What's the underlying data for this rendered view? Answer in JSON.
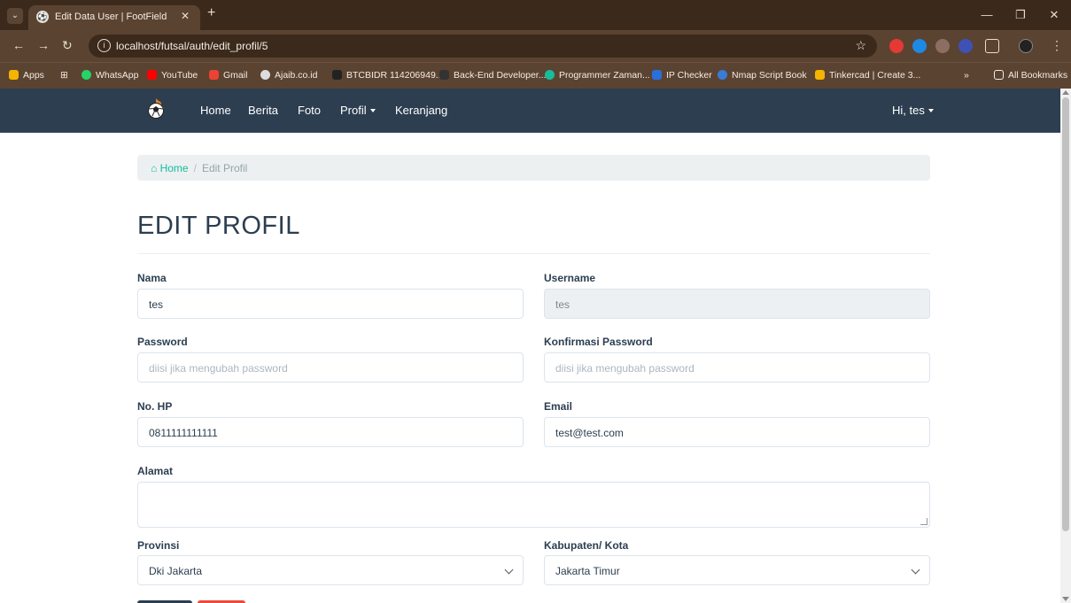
{
  "browser": {
    "tab_title": "Edit Data User | FootField",
    "url": "localhost/futsal/auth/edit_profil/5",
    "bookmarks": [
      {
        "label": "Apps",
        "color": "#f4b400"
      },
      {
        "label": "WhatsApp",
        "color": "#25d366"
      },
      {
        "label": "YouTube",
        "color": "#ff0000"
      },
      {
        "label": "Gmail",
        "color": "#ea4335"
      },
      {
        "label": "Ajaib.co.id",
        "color": "#dddddd"
      },
      {
        "label": "BTCBIDR 114206949...",
        "color": "#222222"
      },
      {
        "label": "Back-End Developer...",
        "color": "#333333"
      },
      {
        "label": "Programmer Zaman...",
        "color": "#18bc9c"
      },
      {
        "label": "IP Checker",
        "color": "#2a6fdb"
      },
      {
        "label": "Nmap Script Book",
        "color": "#3a7bd5"
      },
      {
        "label": "Tinkercad | Create 3...",
        "color": "#f4b400"
      }
    ],
    "all_bookmarks": "All Bookmarks"
  },
  "navbar": {
    "items": [
      "Home",
      "Berita",
      "Foto",
      "Profil",
      "Keranjang"
    ],
    "user": "Hi, tes"
  },
  "breadcrumb": {
    "home": "Home",
    "current": "Edit Profil"
  },
  "page_title": "EDIT PROFIL",
  "form": {
    "nama": {
      "label": "Nama",
      "value": "tes"
    },
    "username": {
      "label": "Username",
      "value": "tes"
    },
    "password": {
      "label": "Password",
      "placeholder": "diisi jika mengubah password"
    },
    "konfirmasi": {
      "label": "Konfirmasi Password",
      "placeholder": "diisi jika mengubah password"
    },
    "hp": {
      "label": "No. HP",
      "value": "0811111111111"
    },
    "email": {
      "label": "Email",
      "value": "test@test.com"
    },
    "alamat": {
      "label": "Alamat",
      "value": ""
    },
    "provinsi": {
      "label": "Provinsi",
      "value": "Dki Jakarta"
    },
    "kota": {
      "label": "Kabupaten/ Kota",
      "value": "Jakarta Timur"
    }
  },
  "colors": {
    "navbar": "#2c3e50",
    "accent": "#18bc9c",
    "danger": "#e74c3c"
  }
}
